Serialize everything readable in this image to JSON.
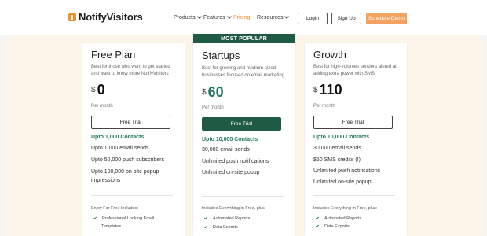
{
  "nav": {
    "logo": "NotifyVisitors",
    "links": [
      "Products",
      "Features",
      "Pricing",
      "Resources"
    ],
    "login": "Login",
    "signup": "Sign Up",
    "demo": "Schedule Demo"
  },
  "plans": [
    {
      "name": "Free Plan",
      "desc": "Best for those who want to get started and want to know more NotifyVisitors",
      "currency": "$",
      "price": "0",
      "period": "Per month",
      "cta": "Free Trial",
      "contacts": "Upto 1,000 Contacts",
      "features": [
        "Upto 1,000 email sends",
        "Upto 50,000 push subscribers",
        "Upto 100,000 on-site popup impressions"
      ],
      "includes_heading": "Enjoy For Free Includes:",
      "includes": [
        "Professional Looking Email",
        "Templates"
      ]
    },
    {
      "banner": "MOST POPULAR",
      "name": "Startups",
      "desc": "Best for growing and medium-sized businesses focused on email marketing.",
      "currency": "$",
      "price": "60",
      "period": "Per month",
      "cta": "Free Trial",
      "contacts": "Upto 10,000 Contacts",
      "features": [
        "30,000 email sends",
        "Unlimited push notifications",
        "Unlimited on-site popup"
      ],
      "includes_heading": "Includes Everything in Free, plus:",
      "includes": [
        "Automated Reports",
        "Data Exports"
      ]
    },
    {
      "name": "Growth",
      "desc": "Best for high-volumes senders aimed at adding extra power with SMS.",
      "currency": "$",
      "price": "110",
      "period": "Per month",
      "cta": "Free Trial",
      "contacts": "Upto 10,000 Contacts",
      "features": [
        "30,000 email sends",
        "$50 SMS credits (!)",
        "Unlimited push notifications",
        "Unlimited on-site popup"
      ],
      "includes_heading": "Includes Everything in Free, plus:",
      "includes": [
        "Automated Reports",
        "Data Exports"
      ]
    }
  ],
  "colors": {
    "accent": "#f28c28",
    "primary_green": "#1f5a45",
    "contact_green": "#1f7a5a",
    "page_bg": "#fdf5ea"
  }
}
